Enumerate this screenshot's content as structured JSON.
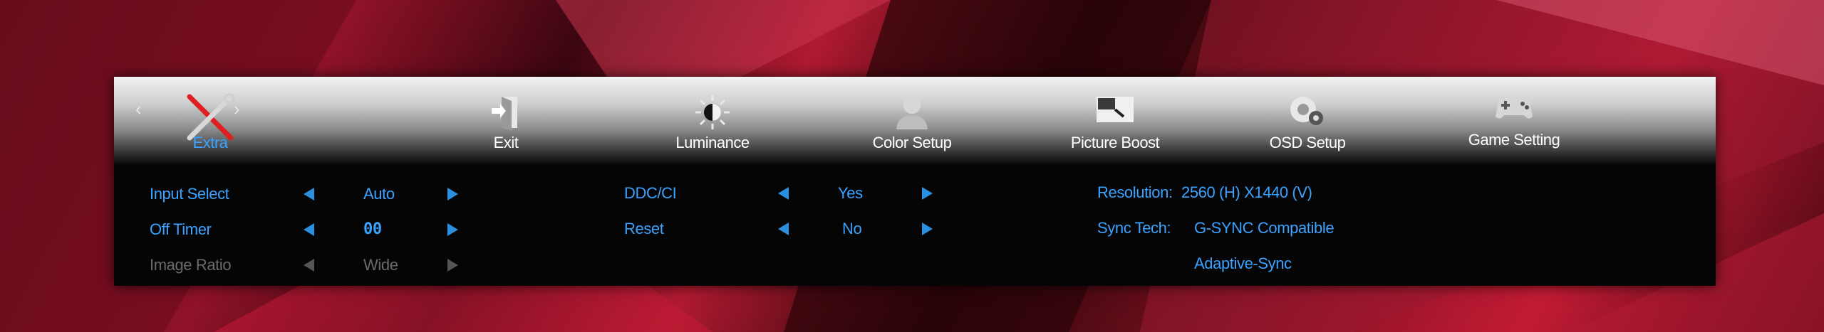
{
  "colors": {
    "accent": "#3aa3ff",
    "disabled": "#6b6b6b",
    "osd_bg": "#050506"
  },
  "tabs": [
    {
      "label": "Extra",
      "icon": "wrench-screwdriver-icon",
      "active": true
    },
    {
      "label": "Exit",
      "icon": "exit-door-icon"
    },
    {
      "label": "Luminance",
      "icon": "brightness-icon"
    },
    {
      "label": "Color Setup",
      "icon": "color-person-icon"
    },
    {
      "label": "Picture Boost",
      "icon": "picture-boost-icon"
    },
    {
      "label": "OSD Setup",
      "icon": "osd-gear-icon"
    },
    {
      "label": "Game Setting",
      "icon": "gamepad-icon"
    }
  ],
  "nav": {
    "prev": "‹",
    "next": "›"
  },
  "settings_left": [
    {
      "label": "Input Select",
      "value": "Auto",
      "enabled": true
    },
    {
      "label": "Off Timer",
      "value": "00",
      "enabled": true
    },
    {
      "label": "Image Ratio",
      "value": "Wide",
      "enabled": false
    }
  ],
  "settings_mid": [
    {
      "label": "DDC/CI",
      "value": "Yes"
    },
    {
      "label": "Reset",
      "value": "No"
    }
  ],
  "info": {
    "resolution_label": "Resolution:",
    "resolution_value": "2560 (H) X1440 (V)",
    "sync_label": "Sync Tech:",
    "sync_value_1": "G-SYNC Compatible",
    "sync_value_2": "Adaptive-Sync"
  }
}
